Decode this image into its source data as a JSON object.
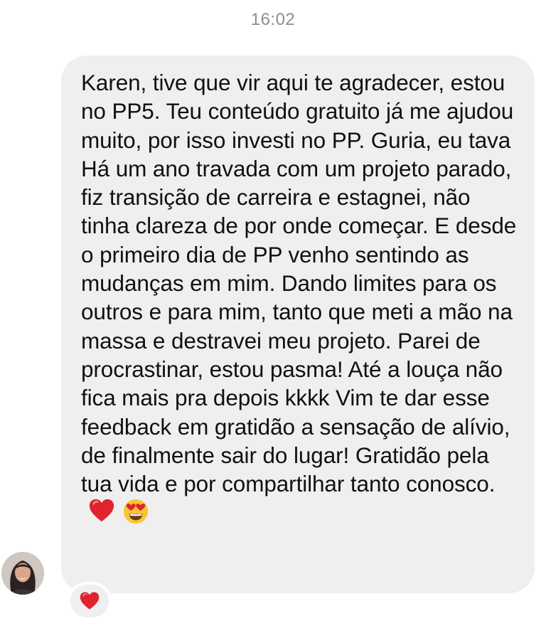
{
  "timestamp": "16:02",
  "message": {
    "text": "Karen, tive que vir aqui te agradecer, estou no PP5. Teu conteúdo gratuito já me ajudou muito, por isso investi no PP. Guria, eu tava Há um ano travada com um projeto parado, fiz transição de carreira e estagnei, não tinha clareza de por onde começar. E desde o primeiro dia de PP venho sentindo as mudanças em mim. Dando limites para os outros e para mim, tanto que meti a mão na massa e destravei meu projeto. Parei de procrastinar, estou pasma! Até a louça não fica mais pra depois kkkk Vim te dar esse feedback em gratidão a sensação de alívio, de finalmente sair do lugar! Gratidão pela tua vida e por compartilhar tanto conosco.",
    "emojis": [
      "red-heart",
      "heart-eyes-face"
    ]
  },
  "reaction": {
    "icon": "red-heart"
  },
  "colors": {
    "bubble": "#efeff0",
    "timestamp": "#8e8e93",
    "heart": "#e0232e",
    "emoji_face": "#f7c631"
  }
}
